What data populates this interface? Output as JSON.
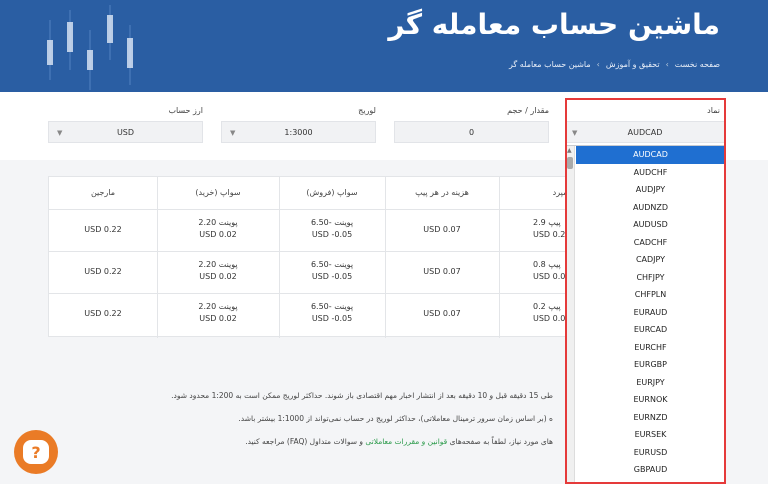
{
  "header": {
    "title": "ماشین حساب معامله گر",
    "breadcrumb": [
      "صفحه نخست",
      "تحقیق و آموزش",
      "ماشین حساب معامله گر"
    ]
  },
  "form": {
    "symbol": {
      "label": "نماد",
      "value": "AUDCAD"
    },
    "volume": {
      "label": "مقدار / حجم",
      "value": "0"
    },
    "leverage": {
      "label": "لوریج",
      "value": "1:3000"
    },
    "currency": {
      "label": "ارز حساب",
      "value": "USD"
    }
  },
  "dropdown": {
    "options": [
      "AUDCAD",
      "AUDCHF",
      "AUDJPY",
      "AUDNZD",
      "AUDUSD",
      "CADCHF",
      "CADJPY",
      "CHFJPY",
      "CHFPLN",
      "EURAUD",
      "EURCAD",
      "EURCHF",
      "EURGBP",
      "EURJPY",
      "EURNOK",
      "EURNZD",
      "EURSEK",
      "EURUSD",
      "GBPAUD",
      "GBPCAD"
    ],
    "selected": "AUDCAD"
  },
  "table": {
    "headers": [
      "اسپرد",
      "هزینه در هر پیپ",
      "سواپ (فروش)",
      "سواپ (خرید)",
      "مارجین"
    ],
    "rows": [
      {
        "spread": [
          "2.9 پیپ",
          "USD 0.2"
        ],
        "pip_cost": "USD 0.07",
        "swap_sell": [
          "6.50- پوینت",
          "USD -0.05"
        ],
        "swap_buy": [
          "2.20 پوینت",
          "USD 0.02"
        ],
        "margin": "USD 0.22"
      },
      {
        "spread": [
          "0.8 پیپ",
          "USD 0.0"
        ],
        "pip_cost": "USD 0.07",
        "swap_sell": [
          "6.50- پوینت",
          "USD -0.05"
        ],
        "swap_buy": [
          "2.20 پوینت",
          "USD 0.02"
        ],
        "margin": "USD 0.22"
      },
      {
        "spread": [
          "0.2 پیپ",
          "USD 0.0"
        ],
        "pip_cost": "USD 0.07",
        "swap_sell": [
          "6.50- پوینت",
          "USD -0.05"
        ],
        "swap_buy": [
          "2.20 پوینت",
          "USD 0.02"
        ],
        "margin": "USD 0.22"
      }
    ]
  },
  "notes": {
    "line1": "طی 15 دقیقه قبل و 10 دقیقه بعد از انتشار اخبار مهم اقتصادی باز شوند. حداکثر لوریج ممکن است به 1:200 محدود شود.",
    "line2": "ه (بر اساس زمان سرور ترمینال معاملاتی)، حداکثر لوریج در حساب نمی‌تواند از 1:1000 بیشتر باشد.",
    "line3_a": "های مورد نیاز، لطفاً به صفحه‌های ",
    "line3_link": "قوانین و مقررات معاملاتی",
    "line3_b": " و سوالات متداول (FAQ) مراجعه کنید."
  },
  "chat": {
    "icon": "question-chat-icon",
    "color": "#ea7b26"
  },
  "colors": {
    "header": "#2a5ea3",
    "selected": "#1f6fd1",
    "highlight_frame": "#e53a3a",
    "link": "#2a9a4a"
  }
}
